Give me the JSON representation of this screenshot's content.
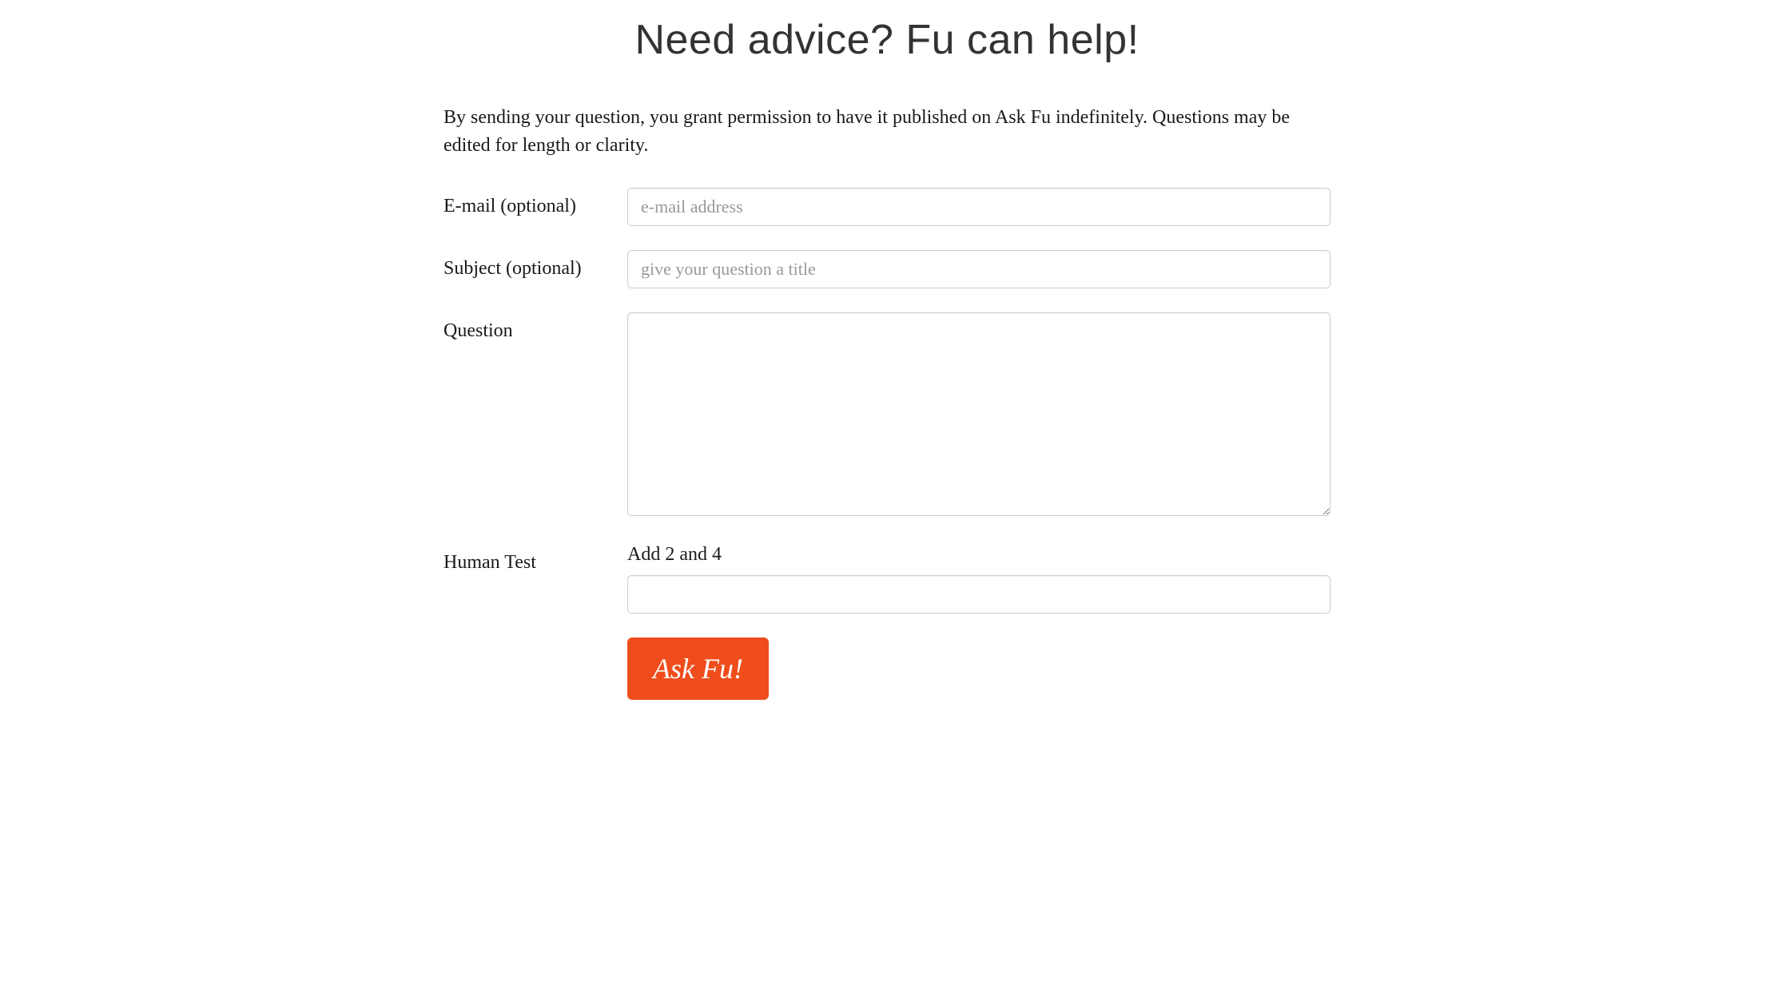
{
  "heading": "Need advice? Fu can help!",
  "intro": "By sending your question, you grant permission to have it published on Ask Fu indefinitely. Questions may be edited for length or clarity.",
  "form": {
    "email": {
      "label": "E-mail (optional)",
      "placeholder": "e-mail address",
      "value": ""
    },
    "subject": {
      "label": "Subject (optional)",
      "placeholder": "give your question a title",
      "value": ""
    },
    "question": {
      "label": "Question",
      "value": ""
    },
    "humanTest": {
      "label": "Human Test",
      "prompt": "Add 2 and 4",
      "value": ""
    },
    "submit": {
      "label": "Ask Fu!"
    }
  }
}
